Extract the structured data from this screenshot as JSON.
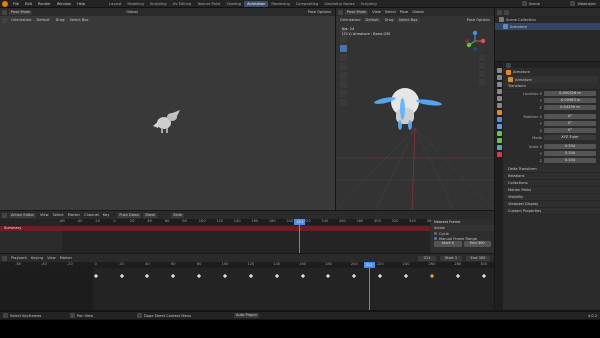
{
  "topbar": {
    "menus": [
      "File",
      "Edit",
      "Render",
      "Window",
      "Help"
    ],
    "workspaces": [
      "Layout",
      "Modeling",
      "Sculpting",
      "UV Editing",
      "Texture Paint",
      "Shading",
      "Animation",
      "Rendering",
      "Compositing",
      "Geometry Nodes",
      "Scripting"
    ],
    "active_workspace": "Animation",
    "scene": "Scene",
    "view_layer": "ViewLayer"
  },
  "left_viewport": {
    "mode": "Pose Mode",
    "orientation_label": "Orientation:",
    "orientation": "Default",
    "drag_label": "Drag:",
    "drag": "Select Box",
    "transform": "Global",
    "pose_options": "Pose Options"
  },
  "right_viewport": {
    "mode": "Pose Mode",
    "menus": [
      "View",
      "Select",
      "Pose"
    ],
    "orientation_label": "Orientation:",
    "orientation": "Default",
    "drag_label": "Drag:",
    "drag": "Select Box",
    "transform": "Global",
    "pose_options": "Pose Options",
    "fps": "fps: 24",
    "object_info": "(211) Armature : Bone.030"
  },
  "outliner": {
    "scene_collection": "Scene Collection",
    "armature": "Armature"
  },
  "properties": {
    "object_name": "Armature",
    "panel_name": "Armature",
    "transform_label": "Transform",
    "location_label": "Location X",
    "location": [
      "0.000326 m",
      "-0.00983 m",
      "0.54259 m"
    ],
    "rotation_label": "Rotation X",
    "rotation": [
      "0°",
      "0°",
      "0°"
    ],
    "mode_label": "Mode",
    "mode": "XYZ Euler",
    "scale_label": "Scale X",
    "scale": [
      "0.334",
      "0.334",
      "0.334"
    ],
    "y_label": "Y",
    "z_label": "Z",
    "sections": [
      "Delta Transform",
      "Relations",
      "Collections",
      "Motion Paths",
      "Visibility",
      "Viewport Display",
      "Custom Properties"
    ]
  },
  "action_editor": {
    "editor": "Action Editor",
    "menus": [
      "View",
      "Select",
      "Marker",
      "Channel",
      "Key"
    ],
    "push_down": "Push Down",
    "stash": "Stash",
    "filter": "Slide",
    "summary": "Summary",
    "ticks": [
      "-60",
      "-40",
      "-20",
      "0",
      "20",
      "40",
      "60",
      "80",
      "100",
      "120",
      "140",
      "160",
      "180",
      "200",
      "220",
      "240",
      "260",
      "280",
      "300",
      "320",
      "340",
      "360"
    ],
    "current_frame": "211",
    "sidebar_editor": "Nearest Frame",
    "action_label": "Action",
    "cycle_label": "Cycle",
    "manual_frame_range": "Manual Frame Range",
    "start_label": "Start",
    "end_label": "End",
    "start_value": "0",
    "end_value": "300"
  },
  "timeline": {
    "playback": "Playback",
    "keying": "Keying",
    "menus": [
      "View",
      "Marker"
    ],
    "frame": "211",
    "start_label": "Start",
    "start": "1",
    "end_label": "End",
    "end": "300",
    "ticks": [
      "-60",
      "-40",
      "-20",
      "0",
      "20",
      "40",
      "60",
      "80",
      "100",
      "120",
      "140",
      "160",
      "180",
      "200",
      "220",
      "240",
      "260",
      "280",
      "300"
    ],
    "current_frame": "211"
  },
  "statusbar": {
    "select": "Select Keyframes",
    "pan": "Pan View",
    "context": "Dope Sheet Context Menu",
    "mode": "Auto Proper",
    "version": "4.0.2"
  },
  "colors": {
    "accent": "#4772b3",
    "playhead": "#4a90e8",
    "summary_row": "#6b1f24",
    "keyframe_selected": "#f0a030",
    "bone": "#5ab0ff"
  }
}
